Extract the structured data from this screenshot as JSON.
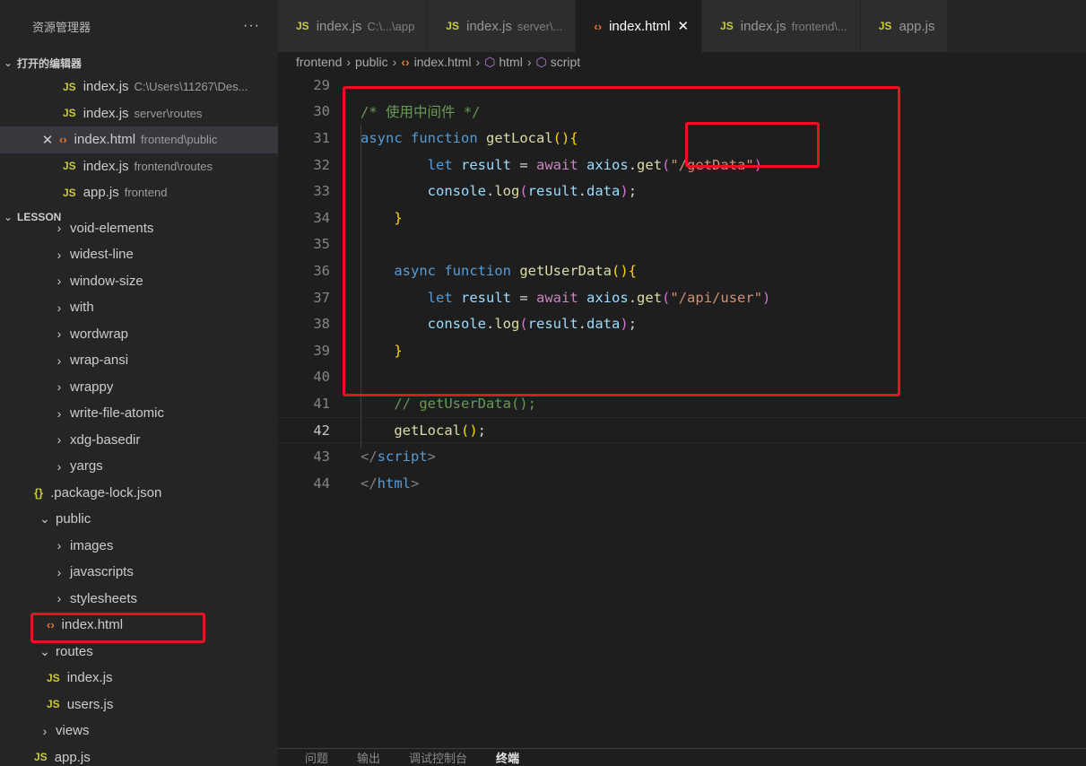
{
  "sidebar": {
    "title": "资源管理器",
    "more": "···",
    "open_editors": {
      "label": "打开的编辑器",
      "items": [
        {
          "icon": "JS",
          "name": "index.js",
          "desc": "C:\\Users\\11267\\Des..."
        },
        {
          "icon": "JS",
          "name": "index.js",
          "desc": "server\\routes"
        },
        {
          "icon": "<>",
          "name": "index.html",
          "desc": "frontend\\public",
          "close": "✕"
        },
        {
          "icon": "JS",
          "name": "index.js",
          "desc": "frontend\\routes"
        },
        {
          "icon": "JS",
          "name": "app.js",
          "desc": "frontend"
        }
      ]
    },
    "lesson": {
      "label": "LESSON",
      "items": [
        {
          "arrow": "›",
          "name": "void-elements"
        },
        {
          "arrow": "›",
          "name": "widest-line"
        },
        {
          "arrow": "›",
          "name": "window-size"
        },
        {
          "arrow": "›",
          "name": "with"
        },
        {
          "arrow": "›",
          "name": "wordwrap"
        },
        {
          "arrow": "›",
          "name": "wrap-ansi"
        },
        {
          "arrow": "›",
          "name": "wrappy"
        },
        {
          "arrow": "›",
          "name": "write-file-atomic"
        },
        {
          "arrow": "›",
          "name": "xdg-basedir"
        },
        {
          "arrow": "›",
          "name": "yargs"
        },
        {
          "icon": "{}",
          "name": ".package-lock.json"
        },
        {
          "arrow": "⌄",
          "name": "public"
        },
        {
          "arrow": "›",
          "name": "images"
        },
        {
          "arrow": "›",
          "name": "javascripts"
        },
        {
          "arrow": "›",
          "name": "stylesheets"
        },
        {
          "icon": "<>",
          "name": "index.html"
        },
        {
          "arrow": "⌄",
          "name": "routes"
        },
        {
          "icon": "JS",
          "name": "index.js"
        },
        {
          "icon": "JS",
          "name": "users.js"
        },
        {
          "arrow": "›",
          "name": "views"
        },
        {
          "icon": "JS",
          "name": "app.js"
        }
      ]
    }
  },
  "tabs": [
    {
      "icon": "JS",
      "name": "index.js",
      "desc": "C:\\...\\app"
    },
    {
      "icon": "JS",
      "name": "index.js",
      "desc": "server\\..."
    },
    {
      "icon": "<>",
      "name": "index.html",
      "desc": "",
      "close": "✕",
      "active": true
    },
    {
      "icon": "JS",
      "name": "index.js",
      "desc": "frontend\\..."
    },
    {
      "icon": "JS",
      "name": "app.js",
      "desc": ""
    }
  ],
  "breadcrumb": [
    "frontend",
    "public",
    "index.html",
    "html",
    "script"
  ],
  "code_lines": [
    {
      "n": "29"
    },
    {
      "n": "30",
      "tokens": [
        [
          "cmt",
          "/* 使用中间件 */"
        ]
      ]
    },
    {
      "n": "31",
      "tokens": [
        [
          "kw",
          "async"
        ],
        [
          "plain",
          " "
        ],
        [
          "kw",
          "function"
        ],
        [
          "plain",
          " "
        ],
        [
          "fn",
          "getLocal"
        ],
        [
          "br1",
          "(){"
        ]
      ]
    },
    {
      "n": "32",
      "tokens": [
        [
          "plain",
          "        "
        ],
        [
          "kw",
          "let"
        ],
        [
          "plain",
          " "
        ],
        [
          "var",
          "result"
        ],
        [
          "plain",
          " = "
        ],
        [
          "kw2",
          "await"
        ],
        [
          "plain",
          " "
        ],
        [
          "var",
          "axios"
        ],
        [
          "plain",
          "."
        ],
        [
          "fn",
          "get"
        ],
        [
          "br2",
          "("
        ],
        [
          "str",
          "\"/getData\""
        ],
        [
          "br2",
          ")"
        ]
      ]
    },
    {
      "n": "33",
      "tokens": [
        [
          "plain",
          "        "
        ],
        [
          "var",
          "console"
        ],
        [
          "plain",
          "."
        ],
        [
          "fn",
          "log"
        ],
        [
          "br2",
          "("
        ],
        [
          "var",
          "result"
        ],
        [
          "plain",
          "."
        ],
        [
          "var",
          "data"
        ],
        [
          "br2",
          ")"
        ],
        [
          "plain",
          ";"
        ]
      ]
    },
    {
      "n": "34",
      "tokens": [
        [
          "plain",
          "    "
        ],
        [
          "br1",
          "}"
        ]
      ]
    },
    {
      "n": "35"
    },
    {
      "n": "36",
      "tokens": [
        [
          "plain",
          "    "
        ],
        [
          "kw",
          "async"
        ],
        [
          "plain",
          " "
        ],
        [
          "kw",
          "function"
        ],
        [
          "plain",
          " "
        ],
        [
          "fn",
          "getUserData"
        ],
        [
          "br1",
          "(){"
        ]
      ]
    },
    {
      "n": "37",
      "tokens": [
        [
          "plain",
          "        "
        ],
        [
          "kw",
          "let"
        ],
        [
          "plain",
          " "
        ],
        [
          "var",
          "result"
        ],
        [
          "plain",
          " = "
        ],
        [
          "kw2",
          "await"
        ],
        [
          "plain",
          " "
        ],
        [
          "var",
          "axios"
        ],
        [
          "plain",
          "."
        ],
        [
          "fn",
          "get"
        ],
        [
          "br2",
          "("
        ],
        [
          "str",
          "\"/api/user\""
        ],
        [
          "br2",
          ")"
        ]
      ]
    },
    {
      "n": "38",
      "tokens": [
        [
          "plain",
          "        "
        ],
        [
          "var",
          "console"
        ],
        [
          "plain",
          "."
        ],
        [
          "fn",
          "log"
        ],
        [
          "br2",
          "("
        ],
        [
          "var",
          "result"
        ],
        [
          "plain",
          "."
        ],
        [
          "var",
          "data"
        ],
        [
          "br2",
          ")"
        ],
        [
          "plain",
          ";"
        ]
      ]
    },
    {
      "n": "39",
      "tokens": [
        [
          "plain",
          "    "
        ],
        [
          "br1",
          "}"
        ]
      ]
    },
    {
      "n": "40"
    },
    {
      "n": "41",
      "tokens": [
        [
          "plain",
          "    "
        ],
        [
          "cmt",
          "// getUserData();"
        ]
      ]
    },
    {
      "n": "42",
      "current": true,
      "tokens": [
        [
          "plain",
          "    "
        ],
        [
          "fn",
          "getLocal"
        ],
        [
          "br1",
          "()"
        ],
        [
          "plain",
          ";"
        ]
      ]
    },
    {
      "n": "43",
      "tokens": [
        [
          "tag",
          "</"
        ],
        [
          "tagn",
          "script"
        ],
        [
          "tag",
          ">"
        ]
      ]
    },
    {
      "n": "44",
      "tokens": [
        [
          "tag",
          "</"
        ],
        [
          "tagn",
          "html"
        ],
        [
          "tag",
          ">"
        ]
      ]
    }
  ],
  "panel_tabs": [
    "问题",
    "输出",
    "调试控制台",
    "终端"
  ],
  "colors": {
    "highlight": "#e81123",
    "js_icon": "#cbcb41",
    "html_icon": "#e37933"
  }
}
